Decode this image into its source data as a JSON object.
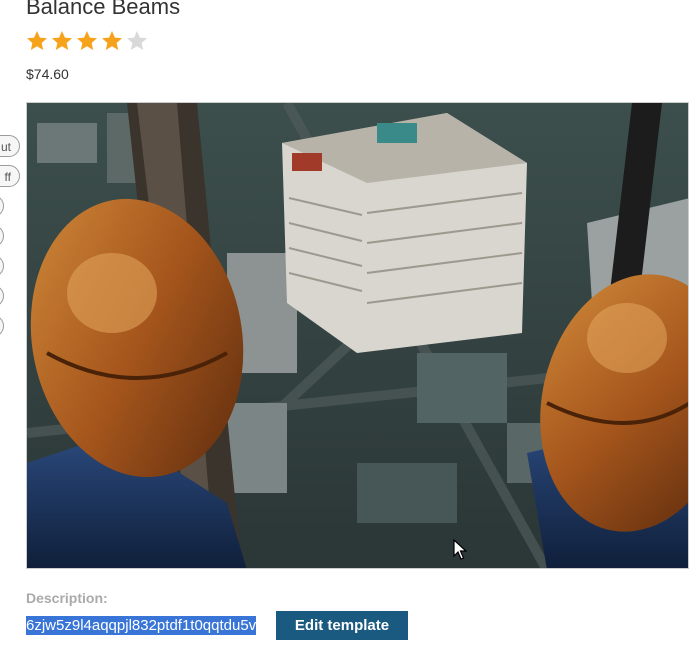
{
  "product": {
    "title": "Balance Beams",
    "rating": {
      "value": 4,
      "max": 5
    },
    "price": "$74.60",
    "image_alt": "Feet in brown boots dangling over a city viewed from high above"
  },
  "side_pills": [
    "ut",
    "ff",
    "",
    "",
    "",
    "",
    ""
  ],
  "description": {
    "label": "Description:",
    "value": "6zjw5z9l4aqqpjl832ptdf1t0qqtdu5v"
  },
  "actions": {
    "edit_template_label": "Edit template"
  },
  "colors": {
    "star_filled": "#f7a21b",
    "star_empty": "#d9d9d9",
    "button_bg": "#1b5a80",
    "selection": "#3875d7"
  }
}
